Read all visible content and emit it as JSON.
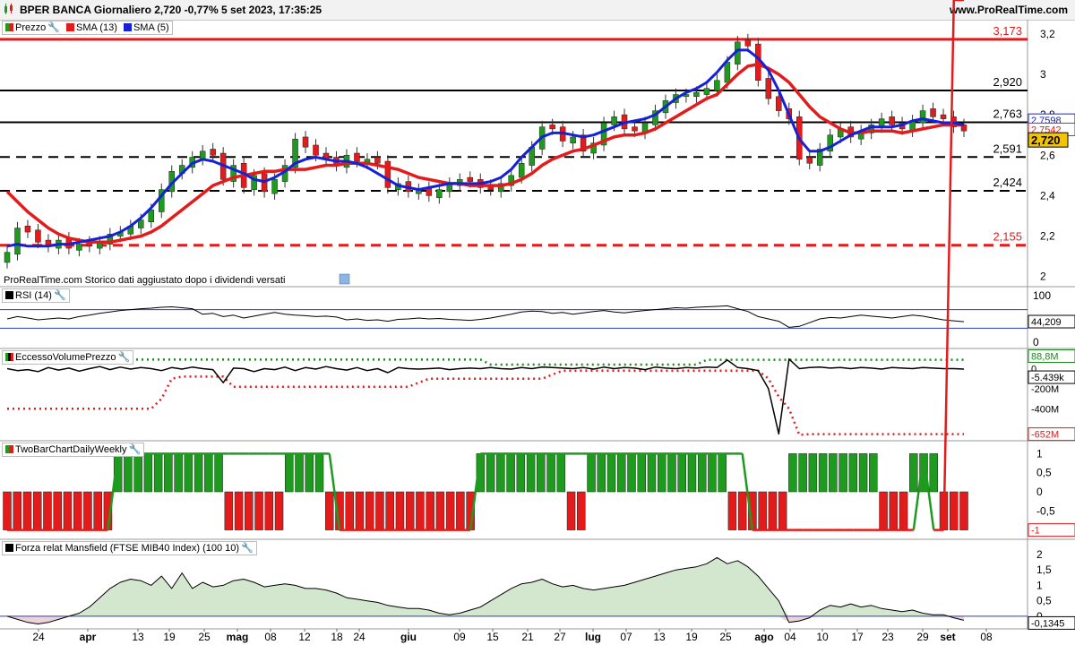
{
  "header": {
    "title": "BPER BANCA Giornaliero 2,720 -0,77% 5 set 2023, 17:35:25",
    "site": "www.ProRealTime.com"
  },
  "note": "ProRealTime.com  Storico dati aggiustato dopo i dividendi versati",
  "panels": {
    "price_label": "Prezzo",
    "sma13_label": "SMA (13)",
    "sma5_label": "SMA (5)",
    "rsi_label": "RSI (14)",
    "evp_label": "EccessoVolumePrezzo",
    "two_bar_label": "TwoBarChartDailyWeekly",
    "mansfield_label": "Forza relat Mansfield (FTSE MIB40 Index) (100 10)"
  },
  "colors": {
    "up": "#1e9a1e",
    "down": "#e31b1b",
    "sma13": "#e31b1b",
    "sma5": "#1521d6",
    "title_bg": "#f2f2f2"
  },
  "chart_data": [
    {
      "type": "candlestick",
      "panel": "price",
      "ylim": [
        1.95,
        3.27
      ],
      "yticks": [
        "2",
        "2,2",
        "2,4",
        "2,6",
        "2,8",
        "3",
        "3,2"
      ],
      "xticks": [
        "24",
        "apr",
        "13",
        "19",
        "25",
        "mag",
        "08",
        "12",
        "18",
        "24",
        "giu",
        "09",
        "15",
        "21",
        "27",
        "lug",
        "07",
        "13",
        "19",
        "25",
        "ago",
        "04",
        "10",
        "17",
        "23",
        "29",
        "set",
        "08"
      ],
      "horizontal_levels": [
        {
          "value": 3.173,
          "label": "3,173",
          "color": "#e31b1b",
          "style": "solid"
        },
        {
          "value": 2.92,
          "label": "2,920",
          "color": "#000000",
          "style": "solid"
        },
        {
          "value": 2.763,
          "label": "2,763",
          "color": "#000000",
          "style": "solid"
        },
        {
          "value": 2.591,
          "label": "2,591",
          "color": "#000000",
          "style": "dashed"
        },
        {
          "value": 2.424,
          "label": "2,424",
          "color": "#000000",
          "style": "dashed"
        },
        {
          "value": 2.155,
          "label": "2,155",
          "color": "#e31b1b",
          "style": "dashed"
        }
      ],
      "last_values": {
        "sma5": "2,7598",
        "sma13": "2,7542",
        "price": "2,720"
      },
      "close": [
        2.12,
        2.24,
        2.22,
        2.17,
        2.15,
        2.18,
        2.14,
        2.16,
        2.15,
        2.17,
        2.21,
        2.22,
        2.25,
        2.28,
        2.33,
        2.43,
        2.52,
        2.55,
        2.59,
        2.62,
        2.6,
        2.48,
        2.55,
        2.44,
        2.5,
        2.42,
        2.48,
        2.55,
        2.68,
        2.64,
        2.6,
        2.58,
        2.55,
        2.6,
        2.57,
        2.58,
        2.56,
        2.44,
        2.46,
        2.42,
        2.43,
        2.4,
        2.43,
        2.46,
        2.48,
        2.47,
        2.44,
        2.43,
        2.46,
        2.5,
        2.56,
        2.64,
        2.74,
        2.73,
        2.67,
        2.69,
        2.62,
        2.66,
        2.76,
        2.79,
        2.73,
        2.72,
        2.76,
        2.82,
        2.87,
        2.9,
        2.9,
        2.91,
        2.93,
        2.97,
        3.06,
        3.16,
        3.14,
        2.97,
        2.88,
        2.82,
        2.78,
        2.58,
        2.56,
        2.63,
        2.7,
        2.73,
        2.69,
        2.72,
        2.75,
        2.78,
        2.75,
        2.73,
        2.77,
        2.82,
        2.79,
        2.78,
        2.74,
        2.72
      ],
      "sma13": [
        2.42,
        2.37,
        2.32,
        2.28,
        2.24,
        2.21,
        2.19,
        2.18,
        2.17,
        2.17,
        2.17,
        2.18,
        2.19,
        2.2,
        2.22,
        2.25,
        2.29,
        2.33,
        2.37,
        2.41,
        2.45,
        2.47,
        2.49,
        2.5,
        2.51,
        2.52,
        2.52,
        2.53,
        2.53,
        2.53,
        2.54,
        2.55,
        2.55,
        2.56,
        2.56,
        2.56,
        2.55,
        2.54,
        2.53,
        2.51,
        2.49,
        2.48,
        2.47,
        2.46,
        2.46,
        2.45,
        2.45,
        2.45,
        2.45,
        2.46,
        2.48,
        2.51,
        2.55,
        2.58,
        2.6,
        2.62,
        2.63,
        2.65,
        2.67,
        2.69,
        2.7,
        2.7,
        2.71,
        2.73,
        2.76,
        2.79,
        2.82,
        2.85,
        2.88,
        2.9,
        2.95,
        3.0,
        3.04,
        3.05,
        3.03,
        3.0,
        2.96,
        2.9,
        2.84,
        2.79,
        2.76,
        2.73,
        2.71,
        2.71,
        2.72,
        2.72,
        2.72,
        2.71,
        2.72,
        2.73,
        2.74,
        2.75,
        2.75,
        2.75
      ],
      "sma5": [
        2.15,
        2.16,
        2.15,
        2.15,
        2.15,
        2.16,
        2.16,
        2.17,
        2.18,
        2.19,
        2.2,
        2.22,
        2.25,
        2.29,
        2.34,
        2.4,
        2.46,
        2.51,
        2.56,
        2.58,
        2.57,
        2.55,
        2.53,
        2.51,
        2.48,
        2.47,
        2.49,
        2.52,
        2.56,
        2.58,
        2.59,
        2.58,
        2.57,
        2.57,
        2.56,
        2.54,
        2.51,
        2.48,
        2.45,
        2.44,
        2.43,
        2.44,
        2.45,
        2.46,
        2.46,
        2.46,
        2.46,
        2.47,
        2.49,
        2.53,
        2.59,
        2.64,
        2.69,
        2.71,
        2.71,
        2.7,
        2.69,
        2.7,
        2.72,
        2.74,
        2.76,
        2.77,
        2.78,
        2.8,
        2.84,
        2.88,
        2.91,
        2.93,
        2.96,
        3.01,
        3.07,
        3.12,
        3.12,
        3.08,
        3.02,
        2.92,
        2.8,
        2.68,
        2.62,
        2.62,
        2.64,
        2.67,
        2.7,
        2.72,
        2.74,
        2.74,
        2.74,
        2.75,
        2.77,
        2.78,
        2.77,
        2.76,
        2.76,
        2.75
      ]
    },
    {
      "type": "line",
      "panel": "rsi",
      "ylim": [
        0,
        100
      ],
      "yticks": [
        "0",
        "100"
      ],
      "bands": [
        70,
        30
      ],
      "last_value": "44,209",
      "values": [
        50,
        55,
        52,
        48,
        50,
        52,
        50,
        55,
        58,
        62,
        65,
        68,
        70,
        72,
        73,
        75,
        76,
        74,
        72,
        60,
        62,
        55,
        58,
        52,
        56,
        60,
        64,
        60,
        58,
        57,
        55,
        56,
        54,
        48,
        50,
        47,
        48,
        45,
        49,
        50,
        52,
        50,
        51,
        49,
        48,
        47,
        49,
        52,
        56,
        60,
        65,
        67,
        66,
        62,
        64,
        60,
        63,
        66,
        68,
        65,
        63,
        66,
        68,
        70,
        72,
        74,
        73,
        75,
        76,
        77,
        78,
        72,
        66,
        55,
        50,
        45,
        32,
        34,
        42,
        50,
        53,
        52,
        55,
        58,
        56,
        54,
        52,
        55,
        58,
        56,
        52,
        48,
        46,
        44
      ]
    },
    {
      "type": "line",
      "panel": "eccesso_volume_prezzo",
      "ylim": [
        -700,
        120
      ],
      "yticks": [
        "0",
        "-200M",
        "-400M"
      ],
      "last_values": {
        "upper": "88,8M",
        "indicator": "-5.439k",
        "lower": "-652M"
      },
      "upper": [
        90,
        90,
        90,
        90,
        90,
        90,
        90,
        90,
        90,
        90,
        90,
        90,
        90,
        90,
        90,
        90,
        90,
        90,
        90,
        90,
        90,
        90,
        90,
        90,
        90,
        90,
        90,
        90,
        90,
        90,
        90,
        90,
        90,
        90,
        90,
        90,
        90,
        90,
        90,
        90,
        90,
        90,
        90,
        90,
        90,
        90,
        90,
        40,
        40,
        40,
        40,
        40,
        40,
        40,
        40,
        40,
        40,
        40,
        40,
        40,
        40,
        40,
        40,
        40,
        40,
        40,
        40,
        40,
        88,
        88,
        88,
        88,
        88,
        88,
        88,
        88,
        88,
        88,
        88,
        88,
        88,
        88,
        88,
        88,
        88,
        88,
        88,
        88,
        88,
        88,
        88,
        88,
        88,
        88
      ],
      "indicator": [
        0,
        -20,
        -10,
        -30,
        10,
        -15,
        5,
        -25,
        0,
        20,
        -10,
        15,
        -5,
        10,
        0,
        -20,
        10,
        -5,
        15,
        0,
        -10,
        -140,
        5,
        0,
        -30,
        0,
        -10,
        15,
        -20,
        10,
        -5,
        20,
        0,
        -15,
        10,
        -20,
        0,
        -40,
        10,
        0,
        -5,
        0,
        5,
        -10,
        0,
        5,
        0,
        10,
        0,
        -5,
        10,
        0,
        15,
        10,
        5,
        0,
        10,
        -5,
        15,
        0,
        10,
        5,
        -10,
        15,
        5,
        0,
        10,
        5,
        15,
        10,
        85,
        10,
        0,
        -20,
        -200,
        -650,
        95,
        0,
        10,
        15,
        5,
        10,
        0,
        10,
        5,
        -5,
        10,
        5,
        0,
        10,
        5,
        0,
        0,
        -5
      ],
      "lower": [
        -400,
        -400,
        -400,
        -400,
        -400,
        -400,
        -400,
        -400,
        -400,
        -400,
        -400,
        -400,
        -400,
        -400,
        -400,
        -300,
        -100,
        -80,
        -80,
        -80,
        -80,
        -80,
        -180,
        -180,
        -180,
        -180,
        -180,
        -180,
        -180,
        -180,
        -180,
        -180,
        -180,
        -180,
        -180,
        -180,
        -180,
        -180,
        -180,
        -180,
        -140,
        -100,
        -100,
        -100,
        -100,
        -100,
        -100,
        -100,
        -100,
        -100,
        -100,
        -100,
        -100,
        -60,
        -20,
        -20,
        -20,
        -20,
        -20,
        -20,
        -20,
        -20,
        -20,
        -20,
        -20,
        -20,
        -20,
        -20,
        -20,
        -20,
        -20,
        -20,
        -20,
        -20,
        -100,
        -280,
        -400,
        -660,
        -652,
        -652,
        -652,
        -652,
        -652,
        -652,
        -652,
        -652,
        -652,
        -652,
        -652,
        -652,
        -652,
        -652,
        -652,
        -652
      ]
    },
    {
      "type": "bar",
      "panel": "two_bar_chart_daily_weekly",
      "ylim": [
        -1.15,
        1.15
      ],
      "yticks": [
        "1",
        "0,5",
        "0",
        "-0,5",
        "-1"
      ],
      "last_value": "-1",
      "values": [
        -1,
        -1,
        -1,
        -1,
        -1,
        -1,
        -1,
        -1,
        -1,
        -1,
        -1,
        1,
        1,
        1,
        1,
        1,
        1,
        1,
        1,
        1,
        1,
        1,
        -1,
        -1,
        -1,
        -1,
        -1,
        -1,
        1,
        1,
        1,
        1,
        -1,
        -1,
        -1,
        -1,
        -1,
        -1,
        -1,
        -1,
        -1,
        -1,
        -1,
        -1,
        -1,
        -1,
        -1,
        1,
        1,
        1,
        1,
        1,
        1,
        1,
        1,
        1,
        -1,
        -1,
        1,
        1,
        1,
        1,
        1,
        1,
        1,
        1,
        1,
        1,
        1,
        1,
        1,
        1,
        -1,
        -1,
        -1,
        -1,
        -1,
        -1,
        1,
        1,
        1,
        1,
        1,
        1,
        1,
        1,
        1,
        -1,
        -1,
        -1,
        1,
        1,
        1,
        -1,
        -1,
        -1
      ],
      "daily": [
        -1,
        -1,
        -1,
        -1,
        -1,
        -1,
        -1,
        -1,
        -1,
        -1,
        -1,
        1,
        1,
        1,
        1,
        1,
        1,
        1,
        1,
        1,
        1,
        1,
        1,
        1,
        1,
        1,
        1,
        1,
        1,
        1,
        1,
        1,
        1,
        -1,
        -1,
        -1,
        -1,
        -1,
        -1,
        -1,
        -1,
        -1,
        -1,
        -1,
        -1,
        -1,
        -1,
        1,
        1,
        1,
        1,
        1,
        1,
        1,
        1,
        1,
        1,
        1,
        1,
        1,
        1,
        1,
        1,
        1,
        1,
        1,
        1,
        1,
        1,
        1,
        1,
        1,
        1,
        1,
        -1,
        -1,
        -1,
        -1,
        -1,
        -1,
        -1,
        -1,
        -1,
        -1,
        -1,
        -1,
        -1,
        -1,
        -1,
        -1,
        -1,
        1,
        -1,
        -1
      ]
    },
    {
      "type": "area",
      "panel": "mansfield",
      "ylim": [
        -0.35,
        2.2
      ],
      "yticks": [
        "0",
        "0,5",
        "1",
        "1,5",
        "2"
      ],
      "last_value": "-0,1345",
      "values": [
        0.0,
        -0.1,
        -0.2,
        -0.25,
        -0.2,
        -0.1,
        0.0,
        0.1,
        0.3,
        0.6,
        0.9,
        1.1,
        1.2,
        1.15,
        1.0,
        1.3,
        0.9,
        1.4,
        0.9,
        1.1,
        0.95,
        1.0,
        1.15,
        1.2,
        1.1,
        0.95,
        1.0,
        1.05,
        1.0,
        0.9,
        0.9,
        0.85,
        0.75,
        0.6,
        0.55,
        0.5,
        0.45,
        0.35,
        0.3,
        0.25,
        0.25,
        0.2,
        0.1,
        0.05,
        0.1,
        0.2,
        0.3,
        0.5,
        0.7,
        0.9,
        1.05,
        1.1,
        1.2,
        1.05,
        0.95,
        1.0,
        0.9,
        0.85,
        0.9,
        0.95,
        1.0,
        1.1,
        1.2,
        1.3,
        1.4,
        1.5,
        1.55,
        1.6,
        1.7,
        1.9,
        1.7,
        1.8,
        1.6,
        1.3,
        0.9,
        0.5,
        -0.2,
        -0.15,
        -0.05,
        0.2,
        0.35,
        0.3,
        0.4,
        0.3,
        0.35,
        0.25,
        0.2,
        0.15,
        0.2,
        0.1,
        0.05,
        0.05,
        -0.05,
        -0.13
      ]
    }
  ]
}
